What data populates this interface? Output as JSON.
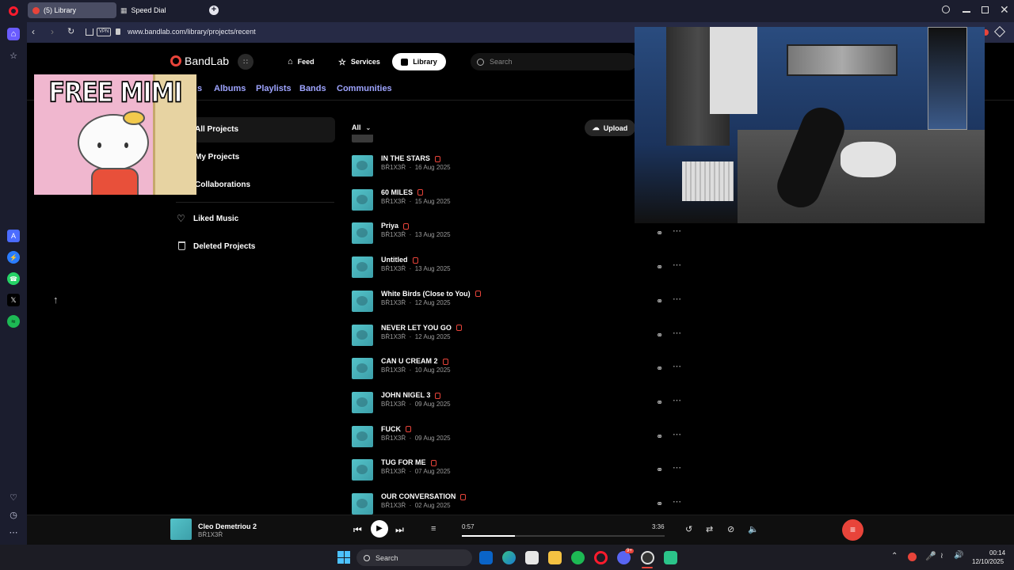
{
  "browser": {
    "tabs": [
      {
        "label": "(5) Library",
        "active": true
      },
      {
        "label": "Speed Dial",
        "active": false
      }
    ],
    "vpn_badge": "VPN",
    "url": "www.bandlab.com/library/projects/recent"
  },
  "bandlab": {
    "logo": "BandLab",
    "nav": {
      "feed": "Feed",
      "services": "Services",
      "library": "Library"
    },
    "search_placeholder": "Search",
    "subtabs": [
      "Projects",
      "Albums",
      "Playlists",
      "Bands",
      "Communities"
    ],
    "subtab_visible_fragment": "s",
    "sidebar": {
      "all_projects": "All Projects",
      "my_projects": "My Projects",
      "collaborations": "Collaborations",
      "liked_music": "Liked Music",
      "deleted_projects": "Deleted Projects"
    },
    "filter": "All",
    "upload": "Upload",
    "projects": [
      {
        "title": "IN THE STARS",
        "artist": "BR̈1X3R̈",
        "date": "16 Aug 2025"
      },
      {
        "title": "60 MILES",
        "artist": "BR̈1X3R̈",
        "date": "15 Aug 2025"
      },
      {
        "title": "Priya",
        "artist": "BR̈1X3R̈",
        "date": "13 Aug 2025"
      },
      {
        "title": "Untitled",
        "artist": "BR̈1X3R̈",
        "date": "13 Aug 2025"
      },
      {
        "title": "White Birds (Close to You)",
        "artist": "BR̈1X3R̈",
        "date": "12 Aug 2025"
      },
      {
        "title": "NEVER LET YOU GO",
        "artist": "BR̈1X3R̈",
        "date": "12 Aug 2025"
      },
      {
        "title": "CAN U CREAM 2",
        "artist": "BR̈1X3R̈",
        "date": "10 Aug 2025"
      },
      {
        "title": "JOHN NIGEL 3",
        "artist": "BR̈1X3R̈",
        "date": "09 Aug 2025"
      },
      {
        "title": "FUCK",
        "artist": "BR̈1X3R̈",
        "date": "09 Aug 2025"
      },
      {
        "title": "TUG FOR ME",
        "artist": "BR̈1X3R̈",
        "date": "07 Aug 2025"
      },
      {
        "title": "OUR CONVERSATION",
        "artist": "BR̈1X3R̈",
        "date": "02 Aug 2025"
      }
    ]
  },
  "overlay": {
    "meme_text": "FREE MIMI"
  },
  "player": {
    "title": "Cleo Demetriou 2",
    "artist": "BR̈1X3R̈",
    "elapsed": "0:57",
    "duration": "3:36",
    "progress": 0.26
  },
  "taskbar": {
    "search_placeholder": "Search",
    "time": "00:14",
    "date": "12/10/2025",
    "discord_badge": "9+"
  },
  "colors": {
    "bandlab_red": "#e8443a",
    "accent_purple": "#9ea4ff",
    "browser_chrome": "#1b1d2e"
  }
}
